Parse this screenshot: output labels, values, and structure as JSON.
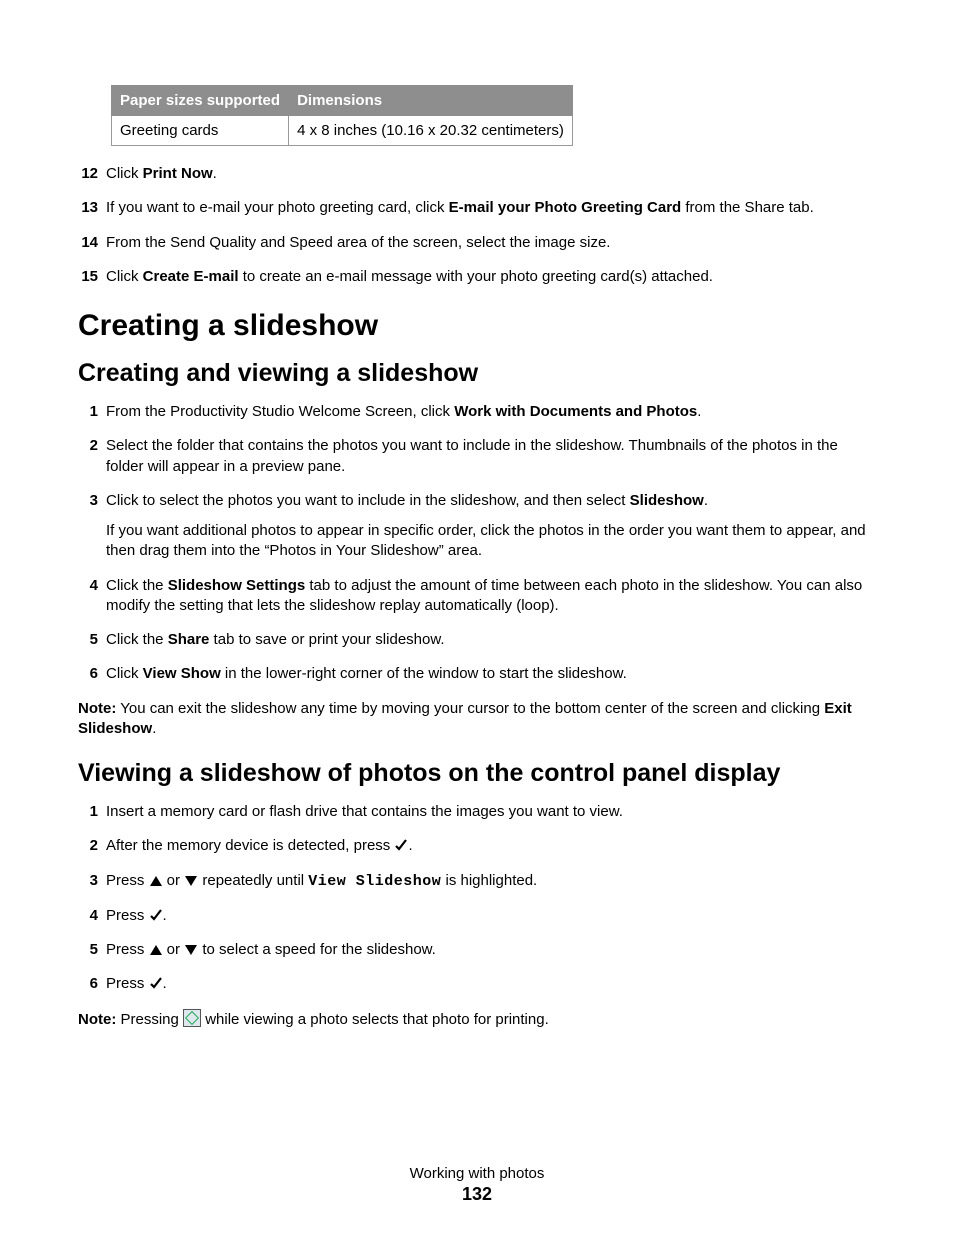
{
  "table": {
    "header_paper": "Paper sizes supported",
    "header_dimensions": "Dimensions",
    "row_paper": "Greeting cards",
    "row_dim": "4 x 8  inches (10.16 x 20.32 centimeters)"
  },
  "top_steps": {
    "n12": "12",
    "s12_a": "Click ",
    "s12_b": "Print Now",
    "s12_c": ".",
    "n13": "13",
    "s13_a": "If you want to e-mail your photo greeting card, click ",
    "s13_b": "E-mail your Photo Greeting Card",
    "s13_c": " from the Share tab.",
    "n14": "14",
    "s14": "From the Send Quality and Speed area of the screen, select the image size.",
    "n15": "15",
    "s15_a": "Click ",
    "s15_b": "Create E-mail",
    "s15_c": " to create an e-mail message with your photo greeting card(s) attached."
  },
  "h1": "Creating a slideshow",
  "h2a": "Creating and viewing a slideshow",
  "sectA": {
    "n1": "1",
    "s1_a": "From the Productivity Studio Welcome Screen, click ",
    "s1_b": "Work with Documents and Photos",
    "s1_c": ".",
    "n2": "2",
    "s2": "Select the folder that contains the photos you want to include in the slideshow. Thumbnails of the photos in the folder will appear in a preview pane.",
    "n3": "3",
    "s3_a": "Click to select the photos you want to include in the slideshow, and then select ",
    "s3_b": "Slideshow",
    "s3_c": ".",
    "s3_sub": "If you want additional photos to appear in specific order, click the photos in the order you want them to appear, and then drag them into the “Photos in Your Slideshow” area.",
    "n4": "4",
    "s4_a": "Click the ",
    "s4_b": "Slideshow Settings",
    "s4_c": " tab to adjust the amount of time between each photo in the slideshow. You can also modify the setting that lets the slideshow replay automatically (loop).",
    "n5": "5",
    "s5_a": "Click the ",
    "s5_b": "Share",
    "s5_c": " tab to save or print your slideshow.",
    "n6": "6",
    "s6_a": "Click ",
    "s6_b": "View Show",
    "s6_c": " in the lower-right corner of the window to start the slideshow."
  },
  "noteA": {
    "label": "Note:",
    "a": " You can exit the slideshow any time by moving your cursor to the bottom center of the screen and clicking ",
    "b": "Exit Slideshow",
    "c": "."
  },
  "h2b": "Viewing a slideshow of photos on the control panel display",
  "sectB": {
    "n1": "1",
    "s1": "Insert a memory card or flash drive that contains the images you want to view.",
    "n2": "2",
    "s2_a": "After the memory device is detected, press ",
    "s2_c": ".",
    "n3": "3",
    "s3_a": "Press ",
    "s3_mid": " or ",
    "s3_b": " repeatedly until ",
    "s3_mono": "View Slideshow",
    "s3_c": " is highlighted.",
    "n4": "4",
    "s4_a": "Press ",
    "s4_c": ".",
    "n5": "5",
    "s5_a": "Press ",
    "s5_mid": " or ",
    "s5_b": " to select a speed for the slideshow.",
    "n6": "6",
    "s6_a": "Press ",
    "s6_c": "."
  },
  "noteB": {
    "label": "Note:",
    "a": " Pressing ",
    "b": " while viewing a photo selects that photo for printing."
  },
  "footer": {
    "section": "Working with photos",
    "page": "132"
  }
}
